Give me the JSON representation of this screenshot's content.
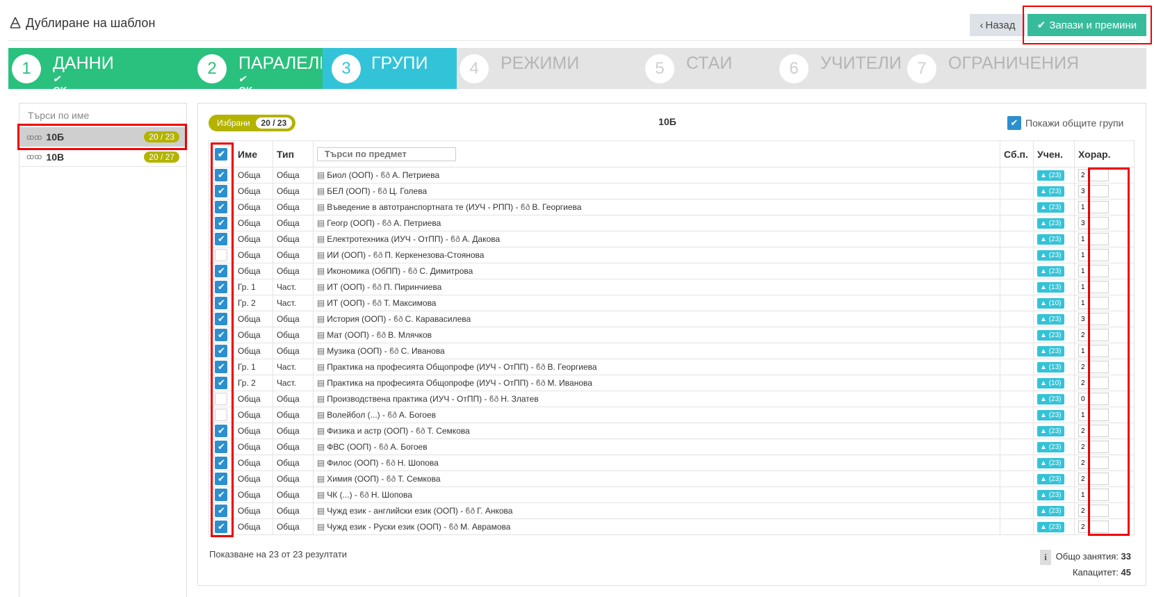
{
  "header": {
    "title": "Дублиране на шаблон",
    "back_label": "Назад",
    "save_label": "Запази и премини"
  },
  "wizard": [
    {
      "num": "1",
      "label": "ДАННИ",
      "status": "done",
      "ok": "OK"
    },
    {
      "num": "2",
      "label": "ПАРАЛЕЛКИ",
      "status": "done",
      "ok": "OK"
    },
    {
      "num": "3",
      "label": "ГРУПИ",
      "status": "active",
      "ok": ""
    },
    {
      "num": "4",
      "label": "РЕЖИМИ",
      "status": "todo",
      "ok": ""
    },
    {
      "num": "5",
      "label": "СТАИ",
      "status": "todo",
      "ok": ""
    },
    {
      "num": "6",
      "label": "УЧИТЕЛИ",
      "status": "todo",
      "ok": ""
    },
    {
      "num": "7",
      "label": "ОГРАНИЧЕНИЯ",
      "status": "todo",
      "ok": ""
    }
  ],
  "colors": {
    "done": "#29c17d",
    "active": "#33c3d8",
    "accent": "#37bc9b",
    "badge": "#b3b300",
    "checkbox": "#2c8fcf",
    "highlight": "#e00000"
  },
  "sidebar": {
    "search_placeholder": "Търси по име",
    "classes": [
      {
        "name": "10Б",
        "count": "20 / 23",
        "selected": true
      },
      {
        "name": "10В",
        "count": "20 / 27",
        "selected": false
      }
    ]
  },
  "main": {
    "selected_label": "Избрани",
    "selected_count": "20 / 23",
    "class_title": "10Б",
    "show_common_label": "Покажи общите групи",
    "show_common_checked": true,
    "columns": {
      "name": "Име",
      "type": "Тип",
      "subject_search_placeholder": "Търси по предмет",
      "combined": "Сб.п.",
      "students": "Учен.",
      "hours": "Хорар."
    },
    "rows": [
      {
        "checked": true,
        "name": "Обща",
        "type": "Обща",
        "subject": "Биол (ООП) - ",
        "teacher": "А. Петриева",
        "students": "(23)",
        "hours": "2"
      },
      {
        "checked": true,
        "name": "Обща",
        "type": "Обща",
        "subject": "БЕЛ (ООП) - ",
        "teacher": "Ц. Голева",
        "students": "(23)",
        "hours": "3"
      },
      {
        "checked": true,
        "name": "Обща",
        "type": "Обща",
        "subject": "Въведение в автотранспортната те (ИУЧ - РПП) - ",
        "teacher": "В. Георгиева",
        "students": "(23)",
        "hours": "1"
      },
      {
        "checked": true,
        "name": "Обща",
        "type": "Обща",
        "subject": "Геогр (ООП) - ",
        "teacher": "А. Петриева",
        "students": "(23)",
        "hours": "3"
      },
      {
        "checked": true,
        "name": "Обща",
        "type": "Обща",
        "subject": "Електротехника (ИУЧ - ОтПП) - ",
        "teacher": "А. Дакова",
        "students": "(23)",
        "hours": "1"
      },
      {
        "checked": false,
        "name": "Обща",
        "type": "Обща",
        "subject": "ИИ (ООП) - ",
        "teacher": "П. Керкенезова-Стоянова",
        "students": "(23)",
        "hours": "1"
      },
      {
        "checked": true,
        "name": "Обща",
        "type": "Обща",
        "subject": "Икономика (ОбПП) - ",
        "teacher": "С. Димитрова",
        "students": "(23)",
        "hours": "1"
      },
      {
        "checked": true,
        "name": "Гр. 1",
        "type": "Част.",
        "subject": "ИТ (ООП) - ",
        "teacher": "П. Пиринчиева",
        "students": "(13)",
        "hours": "1"
      },
      {
        "checked": true,
        "name": "Гр. 2",
        "type": "Част.",
        "subject": "ИТ (ООП) - ",
        "teacher": "Т. Максимова",
        "students": "(10)",
        "hours": "1"
      },
      {
        "checked": true,
        "name": "Обща",
        "type": "Обща",
        "subject": "История (ООП) - ",
        "teacher": "С. Каравасилева",
        "students": "(23)",
        "hours": "3"
      },
      {
        "checked": true,
        "name": "Обща",
        "type": "Обща",
        "subject": "Мат (ООП) - ",
        "teacher": "В. Млячков",
        "students": "(23)",
        "hours": "2"
      },
      {
        "checked": true,
        "name": "Обща",
        "type": "Обща",
        "subject": "Музика (ООП) - ",
        "teacher": "С. Иванова",
        "students": "(23)",
        "hours": "1"
      },
      {
        "checked": true,
        "name": "Гр. 1",
        "type": "Част.",
        "subject": "Практика на професията Общопрофе (ИУЧ - ОтПП) - ",
        "teacher": "В. Георгиева",
        "students": "(13)",
        "hours": "2"
      },
      {
        "checked": true,
        "name": "Гр. 2",
        "type": "Част.",
        "subject": "Практика на професията Общопрофе (ИУЧ - ОтПП) - ",
        "teacher": "М. Иванова",
        "students": "(10)",
        "hours": "2"
      },
      {
        "checked": false,
        "name": "Обща",
        "type": "Обща",
        "subject": "Производствена практика (ИУЧ - ОтПП) - ",
        "teacher": "Н. Златев",
        "students": "(23)",
        "hours": "0"
      },
      {
        "checked": false,
        "name": "Обща",
        "type": "Обща",
        "subject": "Волейбол (...) - ",
        "teacher": "А. Богоев",
        "students": "(23)",
        "hours": "1"
      },
      {
        "checked": true,
        "name": "Обща",
        "type": "Обща",
        "subject": "Физика и астр (ООП) - ",
        "teacher": "Т. Семкова",
        "students": "(23)",
        "hours": "2"
      },
      {
        "checked": true,
        "name": "Обща",
        "type": "Обща",
        "subject": "ФВС (ООП) - ",
        "teacher": "А. Богоев",
        "students": "(23)",
        "hours": "2"
      },
      {
        "checked": true,
        "name": "Обща",
        "type": "Обща",
        "subject": "Филос (ООП) - ",
        "teacher": "Н. Шопова",
        "students": "(23)",
        "hours": "2"
      },
      {
        "checked": true,
        "name": "Обща",
        "type": "Обща",
        "subject": "Химия (ООП) - ",
        "teacher": "Т. Семкова",
        "students": "(23)",
        "hours": "2"
      },
      {
        "checked": true,
        "name": "Обща",
        "type": "Обща",
        "subject": "ЧК (...) - ",
        "teacher": "Н. Шопова",
        "students": "(23)",
        "hours": "1"
      },
      {
        "checked": true,
        "name": "Обща",
        "type": "Обща",
        "subject": "Чужд език - английски език (ООП) - ",
        "teacher": "Г. Анкова",
        "students": "(23)",
        "hours": "2"
      },
      {
        "checked": true,
        "name": "Обща",
        "type": "Обща",
        "subject": "Чужд език - Руски език (ООП) - ",
        "teacher": "М. Аврамова",
        "students": "(23)",
        "hours": "2"
      }
    ],
    "results_text": "Показване на 23 от 23 резултати",
    "total_label": "Общо занятия:",
    "total_value": "33",
    "capacity_label": "Капацитет:",
    "capacity_value": "45"
  }
}
